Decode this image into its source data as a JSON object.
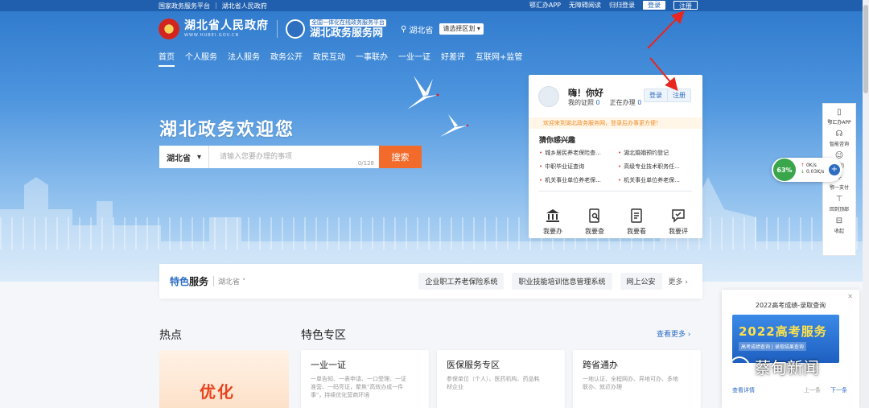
{
  "topbar": {
    "links": [
      "国家政务服务平台",
      "湖北省人民政府"
    ],
    "app": "鄂汇办APP",
    "accessible": "无障碍阅读",
    "senior": "归归登录",
    "login": "登录",
    "register": "注册"
  },
  "header": {
    "gov_name": "湖北省人民政府",
    "gov_domain": "WWW.HUBEI.GOV.CN",
    "svc_tag": "全国一体化在线政务服务平台",
    "svc_name": "湖北政务服务网",
    "location": "湖北省",
    "region_select": "请选择区划"
  },
  "nav": [
    "首页",
    "个人服务",
    "法人服务",
    "政务公开",
    "政民互动",
    "一事联办",
    "一业一证",
    "好差评",
    "互联网+监管"
  ],
  "hero": {
    "welcome": "湖北政务欢迎您",
    "scope": "湖北省",
    "search_placeholder": "请输入您要办理的事项",
    "search_count": "0/128",
    "search_button": "搜索"
  },
  "card": {
    "greeting": "嗨！你好",
    "my_cert_label": "我的证照",
    "my_cert_count": "0",
    "in_progress_label": "正在办理",
    "in_progress_count": "0",
    "login": "登录",
    "register": "注册",
    "notice": "欢迎来到湖北政务服务网，登录后办事更方便！",
    "guess_title": "猜你感兴趣",
    "guess": [
      "城乡居民养老保险查...",
      "湖北婚姻预约登记",
      "中职毕业证查询",
      "高级专业技术职务任...",
      "机关事业单位养老保...",
      "机关事业单位养老保..."
    ],
    "actions": [
      "我要办",
      "我要查",
      "我要看",
      "我要评"
    ]
  },
  "feature_strip": {
    "title_a": "特色",
    "title_b": "服务",
    "location": "湖北省",
    "chips": [
      "企业职工养老保险系统",
      "职业技能培训信息管理系统",
      "网上公安"
    ],
    "more": "更多"
  },
  "sections": {
    "hot": "热点",
    "special": "特色专区",
    "see_more": "查看更多",
    "promo_text": "优化"
  },
  "tiles": [
    {
      "title": "一业一证",
      "desc": "一单告知、一表申请、一口受理、一证准营、一码亮证，聚焦\"高效办成一件事\"，持续优化营商环境"
    },
    {
      "title": "医保服务专区",
      "desc": "参保单位（个人）、医药机构、药品耗材企业"
    },
    {
      "title": "跨省通办",
      "desc": "一地认证、全程网办、异地可办、多地联办、就近办理"
    }
  ],
  "sidebar": [
    "鄂汇办APP",
    "智能咨询",
    "我的",
    "鄂一支付",
    "回到顶部",
    "收起"
  ],
  "net_monitor": {
    "percent": "63%",
    "up": "0K/s",
    "down": "0.03K/s"
  },
  "ad": {
    "title": "2022高考成绩-录取查询",
    "banner_title": "2022高考服务",
    "banner_sub": "高考成绩查询 | 录取结果查询",
    "detail": "查看详情",
    "prev": "上一条",
    "next": "下一条"
  },
  "watermark": "蔡甸新闻",
  "colors": {
    "primary": "#2c6cc1",
    "search_button": "#f36b2b",
    "notice": "#f08a24"
  }
}
